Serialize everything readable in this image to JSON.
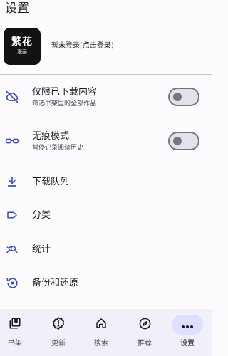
{
  "header": {
    "title": "设置"
  },
  "account": {
    "logo_main": "繁花",
    "logo_sub": "漫画",
    "login_text": "暂未登录(点击登录)"
  },
  "settings": {
    "downloaded_only": {
      "title": "仅限已下载内容",
      "subtitle": "筛选书架里的全部作品",
      "icon": "cloud-off-icon",
      "enabled": false
    },
    "incognito": {
      "title": "无痕模式",
      "subtitle": "暂停记录阅读历史",
      "icon": "glasses-icon",
      "enabled": false
    }
  },
  "menu": [
    {
      "label": "下载队列",
      "icon": "download-icon"
    },
    {
      "label": "分类",
      "icon": "label-icon"
    },
    {
      "label": "统计",
      "icon": "stats-icon"
    },
    {
      "label": "备份和还原",
      "icon": "backup-restore-icon"
    }
  ],
  "bottom_nav": [
    {
      "label": "书架",
      "icon": "library-icon",
      "active": false
    },
    {
      "label": "更新",
      "icon": "updates-icon",
      "active": false
    },
    {
      "label": "搜索",
      "icon": "browse-icon",
      "active": false
    },
    {
      "label": "推荐",
      "icon": "explore-icon",
      "active": false
    },
    {
      "label": "设置",
      "icon": "more-icon",
      "active": true
    }
  ],
  "colors": {
    "background": "#fefbff",
    "icon_accent": "#3a50c0",
    "nav_background": "#f1eff8",
    "active_pill": "#dde1ff"
  }
}
